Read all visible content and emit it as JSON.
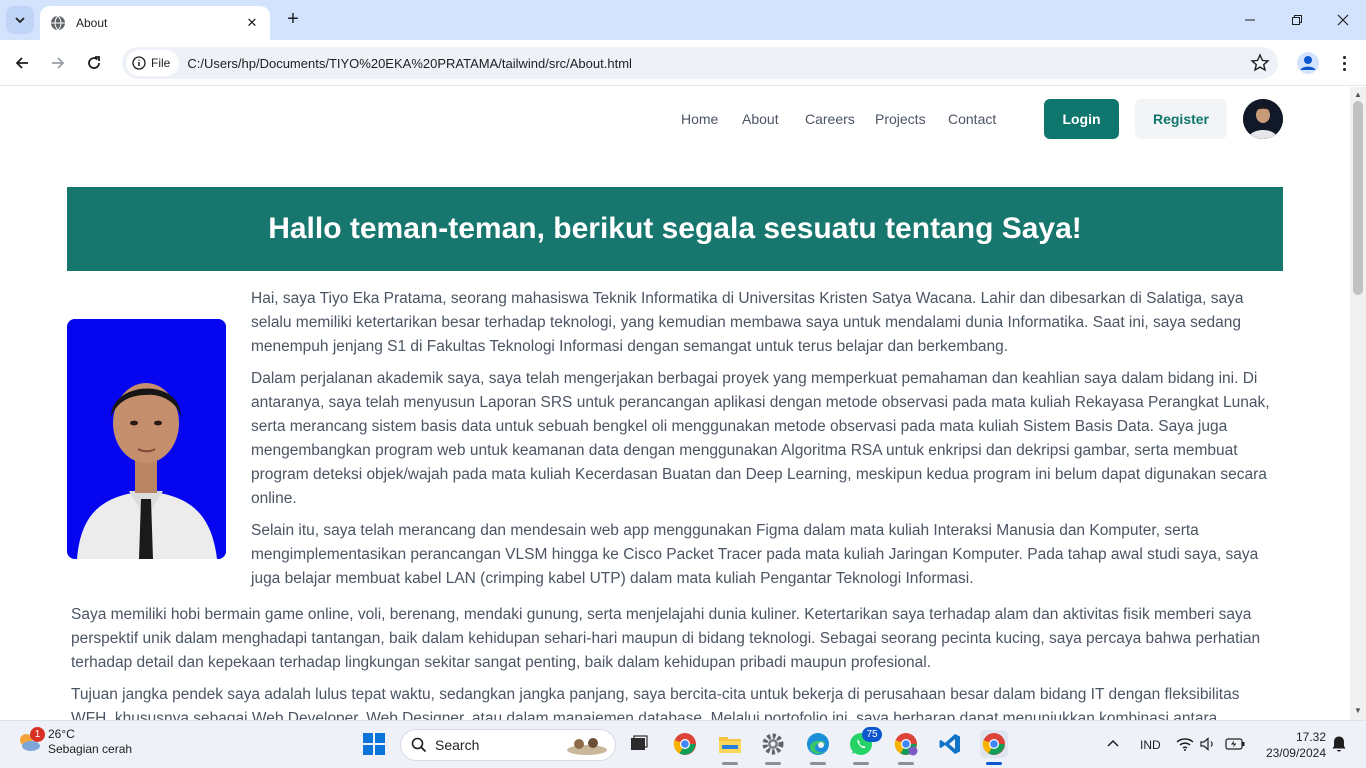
{
  "browser": {
    "tab_title": "About",
    "file_label": "File",
    "url": "C:/Users/hp/Documents/TIYO%20EKA%20PRATAMA/tailwind/src/About.html"
  },
  "site": {
    "nav": [
      "Home",
      "About",
      "Careers",
      "Projects",
      "Contact"
    ],
    "login_label": "Login",
    "register_label": "Register",
    "hero_title": "Hallo teman-teman, berikut segala sesuatu tentang Saya!",
    "paragraphs": [
      "Hai, saya Tiyo Eka Pratama, seorang mahasiswa Teknik Informatika di Universitas Kristen Satya Wacana. Lahir dan dibesarkan di Salatiga, saya selalu memiliki ketertarikan besar terhadap teknologi, yang kemudian membawa saya untuk mendalami dunia Informatika. Saat ini, saya sedang menempuh jenjang S1 di Fakultas Teknologi Informasi dengan semangat untuk terus belajar dan berkembang.",
      "Dalam perjalanan akademik saya, saya telah mengerjakan berbagai proyek yang memperkuat pemahaman dan keahlian saya dalam bidang ini. Di antaranya, saya telah menyusun Laporan SRS untuk perancangan aplikasi dengan metode observasi pada mata kuliah Rekayasa Perangkat Lunak, serta merancang sistem basis data untuk sebuah bengkel oli menggunakan metode observasi pada mata kuliah Sistem Basis Data. Saya juga mengembangkan program web untuk keamanan data dengan menggunakan Algoritma RSA untuk enkripsi dan dekripsi gambar, serta membuat program deteksi objek/wajah pada mata kuliah Kecerdasan Buatan dan Deep Learning, meskipun kedua program ini belum dapat digunakan secara online.",
      "Selain itu, saya telah merancang dan mendesain web app menggunakan Figma dalam mata kuliah Interaksi Manusia dan Komputer, serta mengimplementasikan perancangan VLSM hingga ke Cisco Packet Tracer pada mata kuliah Jaringan Komputer. Pada tahap awal studi saya, saya juga belajar membuat kabel LAN (crimping kabel UTP) dalam mata kuliah Pengantar Teknologi Informasi.",
      "Saya memiliki hobi bermain game online, voli, berenang, mendaki gunung, serta menjelajahi dunia kuliner. Ketertarikan saya terhadap alam dan aktivitas fisik memberi saya perspektif unik dalam menghadapi tantangan, baik dalam kehidupan sehari-hari maupun di bidang teknologi. Sebagai seorang pecinta kucing, saya percaya bahwa perhatian terhadap detail dan kepekaan terhadap lingkungan sekitar sangat penting, baik dalam kehidupan pribadi maupun profesional.",
      "Tujuan jangka pendek saya adalah lulus tepat waktu, sedangkan jangka panjang, saya bercita-cita untuk bekerja di perusahaan besar dalam bidang IT dengan fleksibilitas WFH, khususnya sebagai Web Developer, Web Designer, atau dalam manajemen database. Melalui portofolio ini, saya berharap dapat menunjukkan kombinasi antara"
    ]
  },
  "taskbar": {
    "weather_temp": "26°C",
    "weather_desc": "Sebagian cerah",
    "weather_badge": "1",
    "search_label": "Search",
    "whatsapp_badge": "75",
    "language": "IND",
    "time": "17.32",
    "date": "23/09/2024"
  },
  "colors": {
    "accent": "#0f766e",
    "hero_bg": "#17766e",
    "portrait_bg": "#0505f0"
  }
}
